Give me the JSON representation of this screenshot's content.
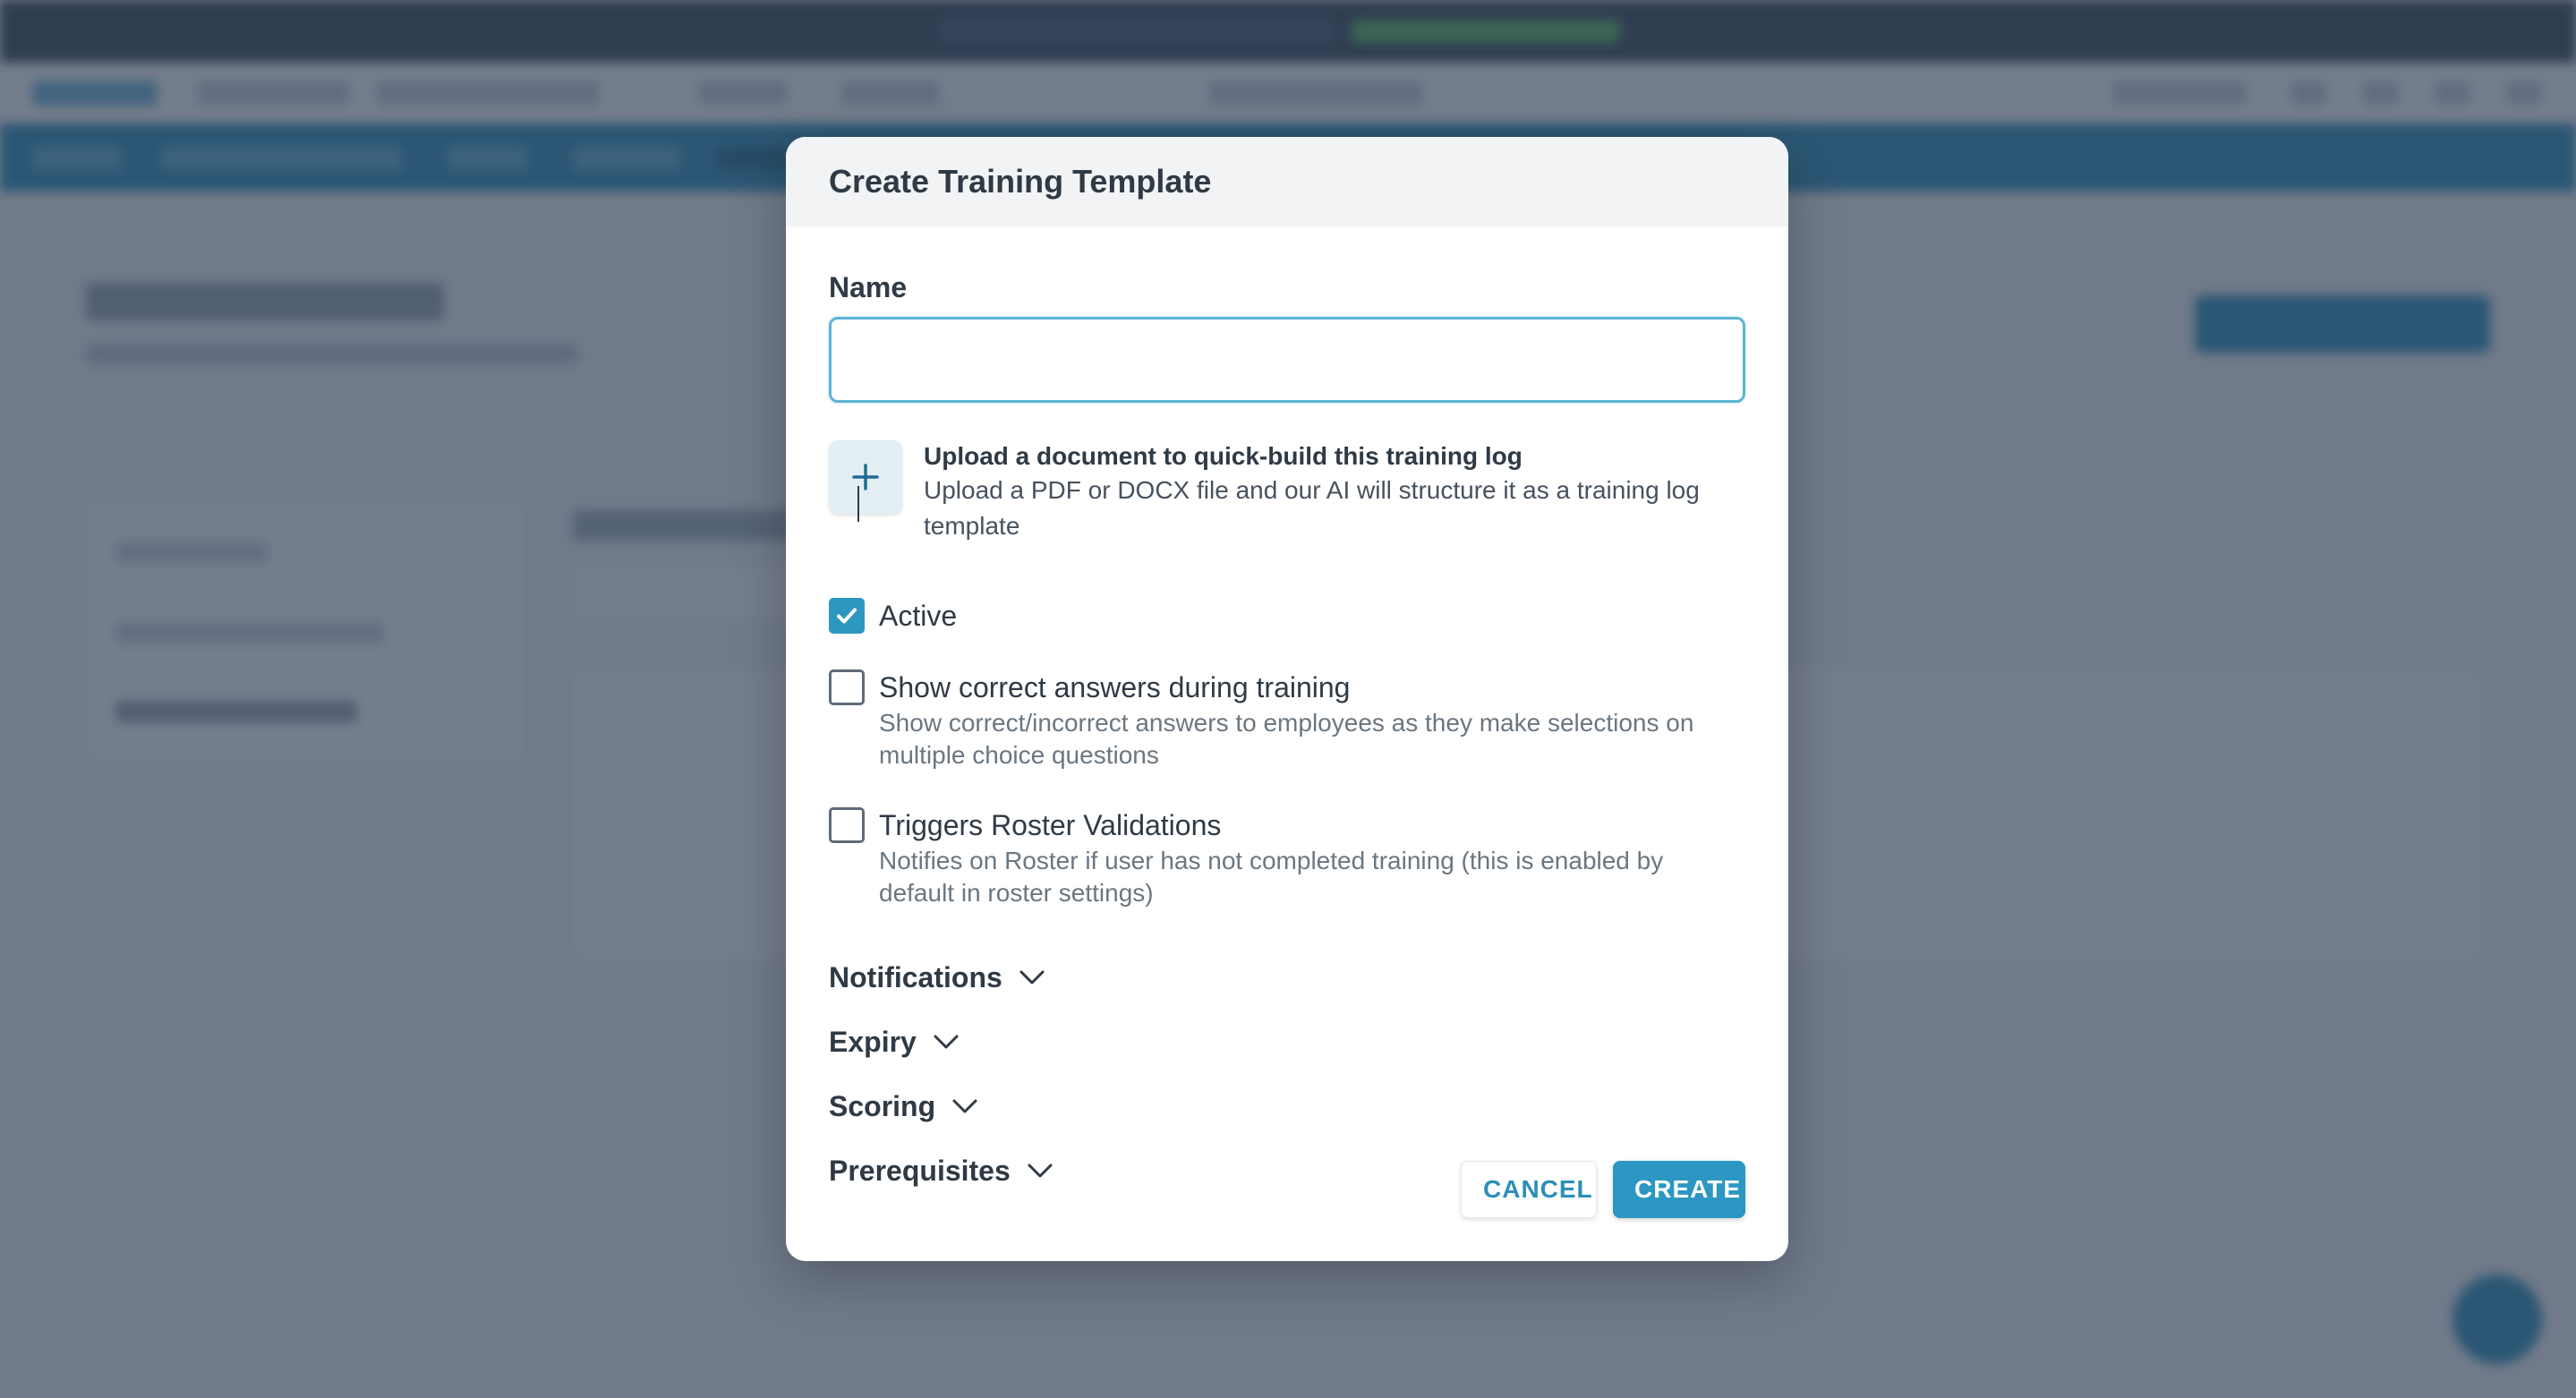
{
  "modal": {
    "title": "Create Training Template",
    "name_label": "Name",
    "name_value": "",
    "upload": {
      "title": "Upload a document to quick-build this training log",
      "description": "Upload a PDF or DOCX file and our AI will structure it as a training log template",
      "icon": "plus-icon"
    },
    "options": [
      {
        "label": "Active",
        "checked": true,
        "description": ""
      },
      {
        "label": "Show correct answers during training",
        "checked": false,
        "description": "Show correct/incorrect answers to employees as they make selections on multiple choice questions"
      },
      {
        "label": "Triggers Roster Validations",
        "checked": false,
        "description": "Notifies on Roster if user has not completed training (this is enabled by default in roster settings)"
      }
    ],
    "sections": [
      "Notifications",
      "Expiry",
      "Scoring",
      "Prerequisites"
    ],
    "cancel_label": "CANCEL",
    "create_label": "CREATE"
  },
  "colors": {
    "accent": "#2b97c2",
    "overlay": "#2c3a50",
    "focus_border": "#5db4d4"
  }
}
